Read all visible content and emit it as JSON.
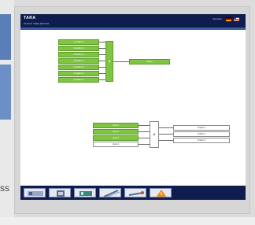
{
  "left_page": {
    "fragment_text": "ss"
  },
  "app": {
    "logo": "TARA",
    "subtitle": "ATTACK TREE EDITOR",
    "header_info": "Operator",
    "flags": [
      "de-flag",
      "us-flag"
    ]
  },
  "tree1": {
    "inputs": [
      "Condition 1",
      "Condition 2",
      "Condition 3",
      "Condition 4",
      "Condition 5",
      "Condition 6",
      "Condition 7"
    ],
    "gate": "&",
    "output": "Output"
  },
  "tree2": {
    "inputs": [
      "Input 1",
      "Input 2",
      "Input 3",
      "Input 4"
    ],
    "gate": "&",
    "outputs": [
      "Output 1",
      "Output 2",
      "Output 3"
    ]
  },
  "toolbar": {
    "tools": [
      "panel-icon",
      "module-icon",
      "device-icon",
      "wire-icon",
      "tool-icon",
      "warning-icon"
    ]
  }
}
